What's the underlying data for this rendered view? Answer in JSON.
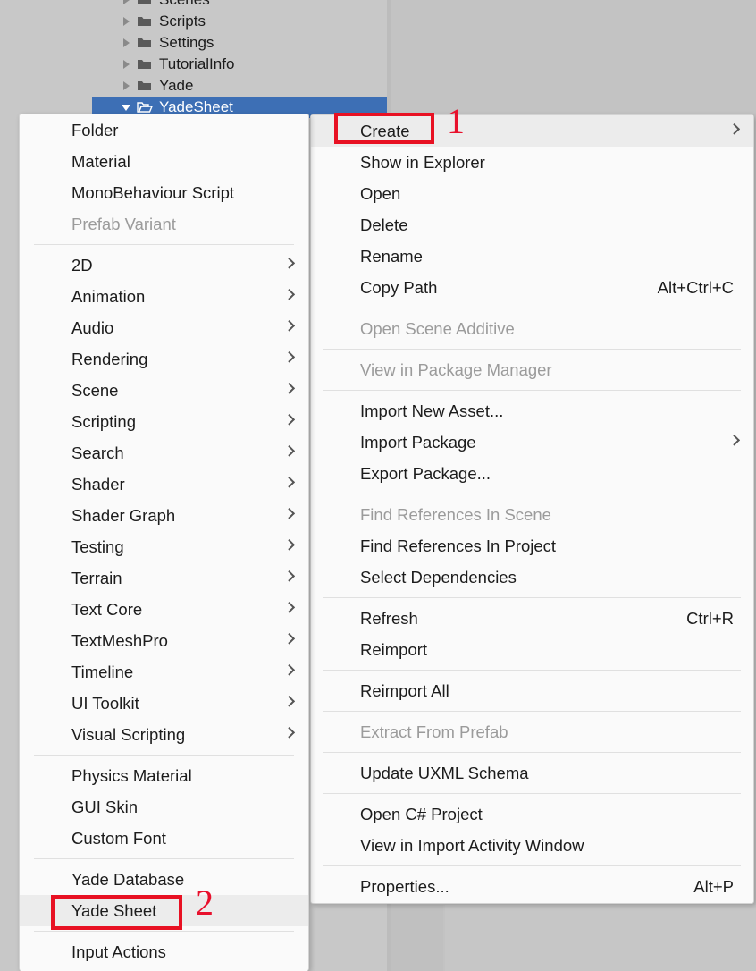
{
  "project_tree": {
    "items": [
      {
        "label": "Scenes",
        "expanded": false,
        "selected": false
      },
      {
        "label": "Scripts",
        "expanded": false,
        "selected": false
      },
      {
        "label": "Settings",
        "expanded": false,
        "selected": false
      },
      {
        "label": "TutorialInfo",
        "expanded": false,
        "selected": false
      },
      {
        "label": "Yade",
        "expanded": false,
        "selected": false
      },
      {
        "label": "YadeSheet",
        "expanded": true,
        "selected": true
      }
    ],
    "selected_color": "#3d6fb5"
  },
  "context_menu": {
    "groups": [
      {
        "items": [
          {
            "label": "Create",
            "submenu": true,
            "disabled": false,
            "shortcut": "",
            "hover": true
          },
          {
            "label": "Show in Explorer",
            "submenu": false,
            "disabled": false,
            "shortcut": ""
          },
          {
            "label": "Open",
            "submenu": false,
            "disabled": false,
            "shortcut": ""
          },
          {
            "label": "Delete",
            "submenu": false,
            "disabled": false,
            "shortcut": ""
          },
          {
            "label": "Rename",
            "submenu": false,
            "disabled": false,
            "shortcut": ""
          },
          {
            "label": "Copy Path",
            "submenu": false,
            "disabled": false,
            "shortcut": "Alt+Ctrl+C"
          }
        ]
      },
      {
        "items": [
          {
            "label": "Open Scene Additive",
            "submenu": false,
            "disabled": true,
            "shortcut": ""
          }
        ]
      },
      {
        "items": [
          {
            "label": "View in Package Manager",
            "submenu": false,
            "disabled": true,
            "shortcut": ""
          }
        ]
      },
      {
        "items": [
          {
            "label": "Import New Asset...",
            "submenu": false,
            "disabled": false,
            "shortcut": ""
          },
          {
            "label": "Import Package",
            "submenu": true,
            "disabled": false,
            "shortcut": ""
          },
          {
            "label": "Export Package...",
            "submenu": false,
            "disabled": false,
            "shortcut": ""
          }
        ]
      },
      {
        "items": [
          {
            "label": "Find References In Scene",
            "submenu": false,
            "disabled": true,
            "shortcut": ""
          },
          {
            "label": "Find References In Project",
            "submenu": false,
            "disabled": false,
            "shortcut": ""
          },
          {
            "label": "Select Dependencies",
            "submenu": false,
            "disabled": false,
            "shortcut": ""
          }
        ]
      },
      {
        "items": [
          {
            "label": "Refresh",
            "submenu": false,
            "disabled": false,
            "shortcut": "Ctrl+R"
          },
          {
            "label": "Reimport",
            "submenu": false,
            "disabled": false,
            "shortcut": ""
          }
        ]
      },
      {
        "items": [
          {
            "label": "Reimport All",
            "submenu": false,
            "disabled": false,
            "shortcut": ""
          }
        ]
      },
      {
        "items": [
          {
            "label": "Extract From Prefab",
            "submenu": false,
            "disabled": true,
            "shortcut": ""
          }
        ]
      },
      {
        "items": [
          {
            "label": "Update UXML Schema",
            "submenu": false,
            "disabled": false,
            "shortcut": ""
          }
        ]
      },
      {
        "items": [
          {
            "label": "Open C# Project",
            "submenu": false,
            "disabled": false,
            "shortcut": ""
          },
          {
            "label": "View in Import Activity Window",
            "submenu": false,
            "disabled": false,
            "shortcut": ""
          }
        ]
      },
      {
        "items": [
          {
            "label": "Properties...",
            "submenu": false,
            "disabled": false,
            "shortcut": "Alt+P"
          }
        ]
      }
    ]
  },
  "create_submenu": {
    "groups": [
      {
        "items": [
          {
            "label": "Folder",
            "submenu": false,
            "disabled": false
          },
          {
            "label": "Material",
            "submenu": false,
            "disabled": false
          },
          {
            "label": "MonoBehaviour Script",
            "submenu": false,
            "disabled": false
          },
          {
            "label": "Prefab Variant",
            "submenu": false,
            "disabled": true
          }
        ]
      },
      {
        "items": [
          {
            "label": "2D",
            "submenu": true,
            "disabled": false
          },
          {
            "label": "Animation",
            "submenu": true,
            "disabled": false
          },
          {
            "label": "Audio",
            "submenu": true,
            "disabled": false
          },
          {
            "label": "Rendering",
            "submenu": true,
            "disabled": false
          },
          {
            "label": "Scene",
            "submenu": true,
            "disabled": false
          },
          {
            "label": "Scripting",
            "submenu": true,
            "disabled": false
          },
          {
            "label": "Search",
            "submenu": true,
            "disabled": false
          },
          {
            "label": "Shader",
            "submenu": true,
            "disabled": false
          },
          {
            "label": "Shader Graph",
            "submenu": true,
            "disabled": false
          },
          {
            "label": "Testing",
            "submenu": true,
            "disabled": false
          },
          {
            "label": "Terrain",
            "submenu": true,
            "disabled": false
          },
          {
            "label": "Text Core",
            "submenu": true,
            "disabled": false
          },
          {
            "label": "TextMeshPro",
            "submenu": true,
            "disabled": false
          },
          {
            "label": "Timeline",
            "submenu": true,
            "disabled": false
          },
          {
            "label": "UI Toolkit",
            "submenu": true,
            "disabled": false
          },
          {
            "label": "Visual Scripting",
            "submenu": true,
            "disabled": false
          }
        ]
      },
      {
        "items": [
          {
            "label": "Physics Material",
            "submenu": false,
            "disabled": false
          },
          {
            "label": "GUI Skin",
            "submenu": false,
            "disabled": false
          },
          {
            "label": "Custom Font",
            "submenu": false,
            "disabled": false
          }
        ]
      },
      {
        "items": [
          {
            "label": "Yade Database",
            "submenu": false,
            "disabled": false
          },
          {
            "label": "Yade Sheet",
            "submenu": false,
            "disabled": false,
            "hover": true
          }
        ]
      },
      {
        "items": [
          {
            "label": "Input Actions",
            "submenu": false,
            "disabled": false
          }
        ]
      }
    ]
  },
  "annotations": {
    "color": "#e8112d",
    "markers": [
      {
        "number": "1",
        "target": "Create"
      },
      {
        "number": "2",
        "target": "Yade Sheet"
      }
    ]
  }
}
